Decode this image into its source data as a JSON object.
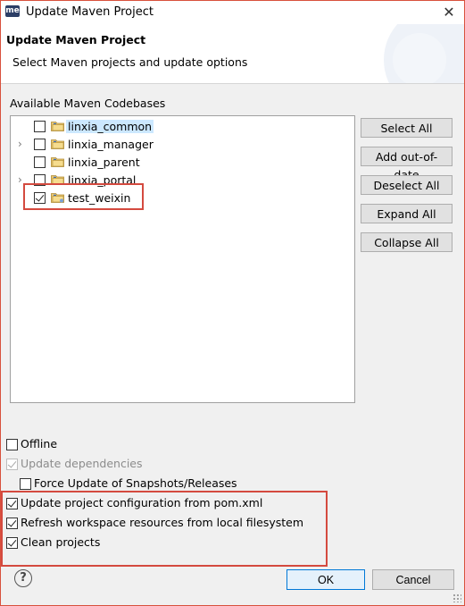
{
  "window": {
    "app_icon": "me",
    "title": "Update Maven Project",
    "close_glyph": "✕"
  },
  "banner": {
    "title": "Update Maven Project",
    "subtitle": "Select Maven projects and update options"
  },
  "codebases": {
    "label": "Available Maven Codebases",
    "items": [
      {
        "label": "linxia_common",
        "checked": false,
        "expandable": false,
        "selected": true
      },
      {
        "label": "linxia_manager",
        "checked": false,
        "expandable": true,
        "selected": false
      },
      {
        "label": "linxia_parent",
        "checked": false,
        "expandable": false,
        "selected": false
      },
      {
        "label": "linxia_portal",
        "checked": false,
        "expandable": true,
        "selected": false
      },
      {
        "label": "test_weixin",
        "checked": true,
        "expandable": false,
        "selected": false
      }
    ]
  },
  "side_buttons": {
    "select_all": "Select All",
    "add_out_of_date": "Add out-of-date",
    "deselect_all": "Deselect All",
    "expand_all": "Expand All",
    "collapse_all": "Collapse All"
  },
  "options": {
    "offline": {
      "label": "Offline",
      "checked": false
    },
    "update_dependencies": {
      "label": "Update dependencies",
      "checked": true,
      "disabled": true
    },
    "force_update": {
      "label": "Force Update of Snapshots/Releases",
      "checked": false
    },
    "update_config": {
      "label": "Update project configuration from pom.xml",
      "checked": true
    },
    "refresh_workspace": {
      "label": "Refresh workspace resources from local filesystem",
      "checked": true
    },
    "clean_projects": {
      "label": "Clean projects",
      "checked": true
    }
  },
  "footer": {
    "help_glyph": "?",
    "ok": "OK",
    "cancel": "Cancel"
  },
  "colors": {
    "highlight": "#d44a3f",
    "selection": "#cce8ff",
    "default_button_border": "#0078d7"
  }
}
